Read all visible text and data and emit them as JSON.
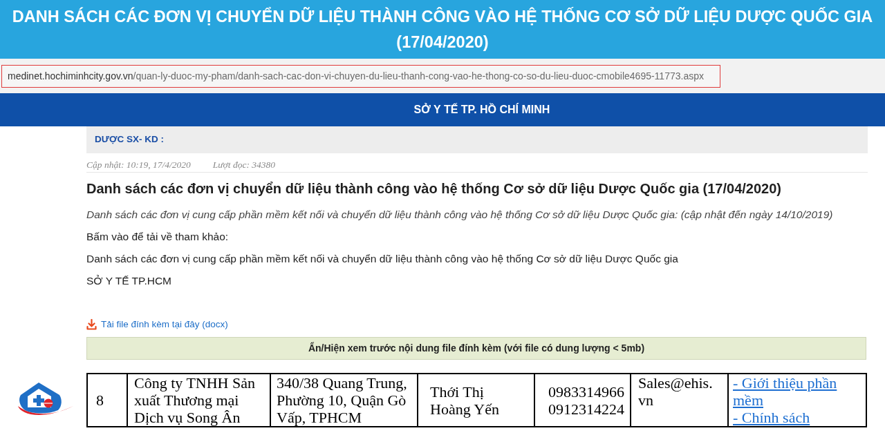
{
  "banner": {
    "title": "DANH SÁCH CÁC ĐƠN VỊ CHUYỂN DỮ LIỆU THÀNH CÔNG VÀO HỆ THỐNG CƠ SỞ DỮ LIỆU DƯỢC QUỐC GIA (17/04/2020)"
  },
  "address_bar": {
    "domain": "medinet.hochiminhcity.gov.vn",
    "path": "/quan-ly-duoc-my-pham/danh-sach-cac-don-vi-chuyen-du-lieu-thanh-cong-vao-he-thong-co-so-du-lieu-duoc-cmobile4695-11773.aspx"
  },
  "site_header": {
    "title": "SỞ Y TẾ TP. HỒ CHÍ MINH"
  },
  "category_bar": {
    "label": "DƯỢC SX- KD :"
  },
  "article": {
    "updated": "Cập nhật: 10:19, 17/4/2020",
    "views": "Lượt đọc: 34380",
    "title": "Danh sách các đơn vị chuyển dữ liệu thành công vào hệ thống Cơ sở dữ liệu Dược Quốc gia (17/04/2020)",
    "paragraphs": [
      {
        "kind": "note",
        "text": "Danh sách các đơn vị cung cấp phần mềm kết nối và chuyển dữ liệu thành công vào hệ thống Cơ sở dữ liệu Dược Quốc gia: (cập nhật đến ngày 14/10/2019)"
      },
      {
        "kind": "plain",
        "text": "Bấm vào để tải về tham khảo:"
      },
      {
        "kind": "plain",
        "text": "Danh sách các đơn vị cung cấp phần mềm kết nối và chuyển dữ liệu thành công vào hệ thống Cơ sở dữ liệu Dược Quốc gia"
      },
      {
        "kind": "plain",
        "text": "SỞ Y TẾ TP.HCM"
      }
    ]
  },
  "attachment": {
    "download_link": "Tải file đính kèm tại đây (docx)",
    "preview_toggle": "Ẩn/Hiện xem trước nội dung file đính kèm (với file có dung lượng < 5mb)"
  },
  "preview_table": {
    "rows": [
      {
        "cells": [
          {
            "kind": "text",
            "text": "8"
          },
          {
            "kind": "text",
            "text": "Công ty TNHH Sản xuất Thương mại Dịch vụ Song Ân"
          },
          {
            "kind": "text",
            "text": "340/38 Quang Trung, Phường 10, Quận Gò Vấp, TPHCM"
          },
          {
            "kind": "text",
            "text": "Thới Thị Hoàng Yến"
          },
          {
            "kind": "lines",
            "lines": [
              "0983314966",
              "0912314224"
            ]
          },
          {
            "kind": "text",
            "text": "Sales@ehis.vn"
          },
          {
            "kind": "links",
            "links": [
              "- Giới thiệu phần mềm",
              "- Chính sách"
            ]
          }
        ]
      }
    ]
  }
}
